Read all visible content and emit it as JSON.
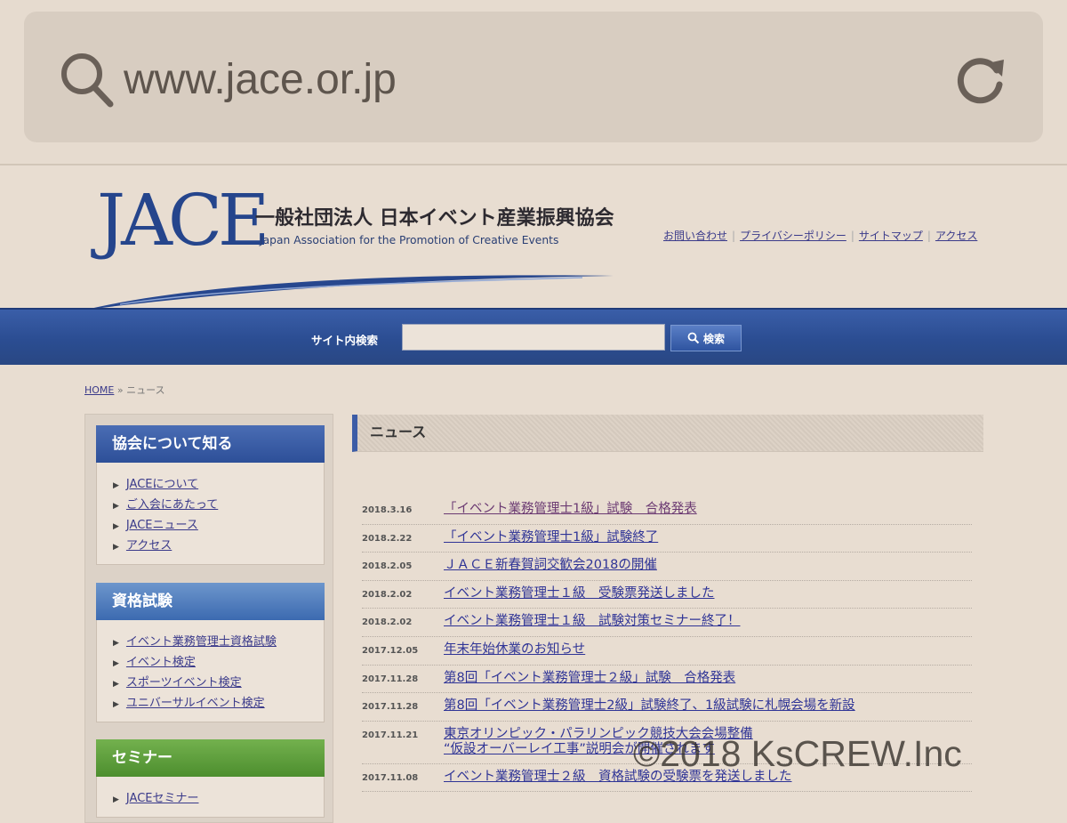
{
  "browser": {
    "url": "www.jace.or.jp",
    "search_icon": "search-icon",
    "reload_icon": "reload-icon"
  },
  "header": {
    "logo_jace": "JACE",
    "logo_japanese": "一般社団法人 日本イベント産業振興協会",
    "logo_english": "Japan Association for the Promotion of Creative Events",
    "links": [
      "お問い合わせ",
      "プライバシーポリシー",
      "サイトマップ",
      "アクセス"
    ]
  },
  "search": {
    "label": "サイト内検索",
    "value": "",
    "button_label": "検索"
  },
  "breadcrumb": {
    "home": "HOME",
    "separator": "»",
    "current": "ニュース"
  },
  "sidebar": {
    "sections": [
      {
        "title": "協会について知る",
        "items": [
          "JACEについて",
          "ご入会にあたって",
          "JACEニュース",
          "アクセス"
        ]
      },
      {
        "title": "資格試験",
        "items": [
          "イベント業務管理士資格試験",
          "イベント検定",
          "スポーツイベント検定",
          "ユニバーサルイベント検定"
        ]
      },
      {
        "title": "セミナー",
        "items": [
          "JACEセミナー"
        ]
      }
    ]
  },
  "main": {
    "title": "ニュース",
    "news": [
      {
        "date": "2018.3.16",
        "title": "「イベント業務管理士1級」試験　合格発表"
      },
      {
        "date": "2018.2.22",
        "title": "「イベント業務管理士1級」試験終了"
      },
      {
        "date": "2018.2.05",
        "title": "ＪＡＣＥ新春賀詞交歓会2018の開催"
      },
      {
        "date": "2018.2.02",
        "title": "イベント業務管理士１級　受験票発送しました"
      },
      {
        "date": "2018.2.02",
        "title": "イベント業務管理士１級　試験対策セミナー終了！"
      },
      {
        "date": "2017.12.05",
        "title": "年末年始休業のお知らせ"
      },
      {
        "date": "2017.11.28",
        "title": "第8回「イベント業務管理士２級」試験　合格発表"
      },
      {
        "date": "2017.11.28",
        "title": "第8回「イベント業務管理士2級」試験終了、1級試験に札幌会場を新設"
      },
      {
        "date": "2017.11.21",
        "title": "東京オリンピック・パラリンピック競技大会会場整備",
        "title2": "“仮設オーバーレイ工事”説明会が開催されます"
      },
      {
        "date": "2017.11.08",
        "title": "イベント業務管理士２級　資格試験の受験票を発送しました"
      }
    ]
  },
  "watermark": "©2018 KsCREW.Inc",
  "colors": {
    "background": "#e8ddd1",
    "brand_blue": "#2b4d92",
    "link": "#2f3496",
    "section_green": "#4d8e2e"
  }
}
